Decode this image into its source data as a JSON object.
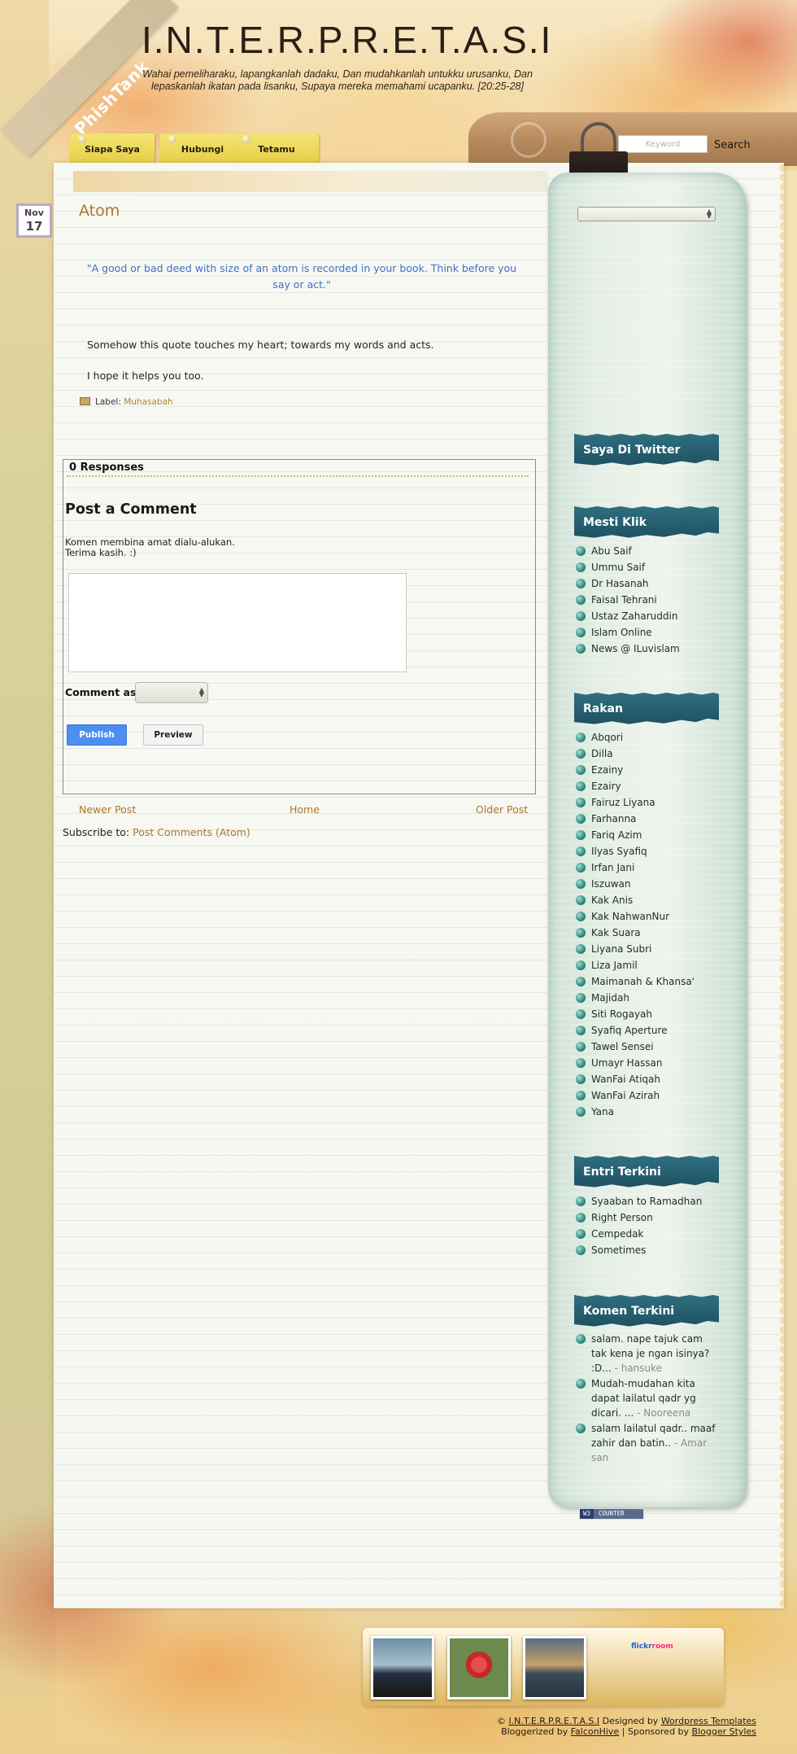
{
  "site": {
    "title": "I.N.T.E.R.P.R.E.T.A.S.I",
    "description": "Wahai pemeliharaku, lapangkanlah dadaku, Dan mudahkanlah untukku urusanku, Dan lepaskanlah ikatan pada lisanku, Supaya mereka memahami ucapanku. [20:25-28]",
    "ribbon": "PhishTank"
  },
  "nav": {
    "tabs": [
      {
        "label": "Siapa Saya"
      },
      {
        "label": "Hubungi"
      },
      {
        "label": "Tetamu"
      }
    ]
  },
  "search": {
    "placeholder": "Keyword",
    "button_label": "Search"
  },
  "post": {
    "date_month": "Nov",
    "date_day": "17",
    "title": "Atom",
    "quote": "\"A good or bad deed with size of an atom is recorded in your book. Think before you say or act.\"",
    "paragraph1": "Somehow this quote touches my heart; towards my words and acts.",
    "paragraph2": "I hope it helps you too.",
    "label_prefix": "Label:",
    "label_link": "Muhasabah"
  },
  "comments": {
    "responses": "0 Responses",
    "post_comment_title": "Post a Comment",
    "note_line1": "Komen membina amat dialu-alukan.",
    "note_line2": "Terima kasih. :)",
    "comment_as_label": "Comment as:",
    "publish_label": "Publish",
    "preview_label": "Preview"
  },
  "pager": {
    "newer": "Newer Post",
    "home": "Home",
    "older": "Older Post"
  },
  "subscribe": {
    "prefix": "Subscribe to:",
    "link": "Post Comments (Atom)"
  },
  "sidebar": {
    "twitter_title": "Saya Di Twitter",
    "mesti_klik_title": "Mesti Klik",
    "mesti_klik": [
      "Abu Saif",
      "Ummu Saif",
      "Dr Hasanah",
      "Faisal Tehrani",
      "Ustaz Zaharuddin",
      "Islam Online",
      "News @ ILuvislam"
    ],
    "rakan_title": "Rakan",
    "rakan": [
      "Abqori",
      "Dilla",
      "Ezainy",
      "Ezairy",
      "Fairuz Liyana",
      "Farhanna",
      "Fariq Azim",
      "Ilyas Syafiq",
      "Irfan Jani",
      "Iszuwan",
      "Kak Anis",
      "Kak NahwanNur",
      "Kak Suara",
      "Liyana Subri",
      "Liza Jamil",
      "Maimanah & Khansa'",
      "Majidah",
      "Siti Rogayah",
      "Syafiq Aperture",
      "Tawel Sensei",
      "Umayr Hassan",
      "WanFai Atiqah",
      "WanFai Azirah",
      "Yana"
    ],
    "entri_title": "Entri Terkini",
    "entri": [
      "Syaaban to Ramadhan",
      "Right Person",
      "Cempedak",
      "Sometimes"
    ],
    "komen_title": "Komen Terkini",
    "komen": [
      {
        "text": "salam. nape tajuk cam tak kena je ngan isinya? :D...",
        "author": "- hansuke"
      },
      {
        "text": "Mudah-mudahan kita dapat lailatul qadr yg dicari. ...",
        "author": "- Nooreena"
      },
      {
        "text": "salam lailatul qadr.. maaf zahir dan batin..",
        "author": "- Amar san"
      }
    ],
    "counter_left": "W3",
    "counter_right": "COUNTER"
  },
  "footer": {
    "flickr_part1": "flickr",
    "flickr_part2": "room",
    "copyright_prefix": "©",
    "site_link": "I.N.T.E.R.P.R.E.T.A.S.I",
    "designed_by": "Designed by",
    "wp_link": "Wordpress Templates",
    "bloggerized_by": "Bloggerized by",
    "fh_link": "FalconHive",
    "sponsored_by": "| Sponsored by",
    "bs_link": "Blogger Styles"
  }
}
